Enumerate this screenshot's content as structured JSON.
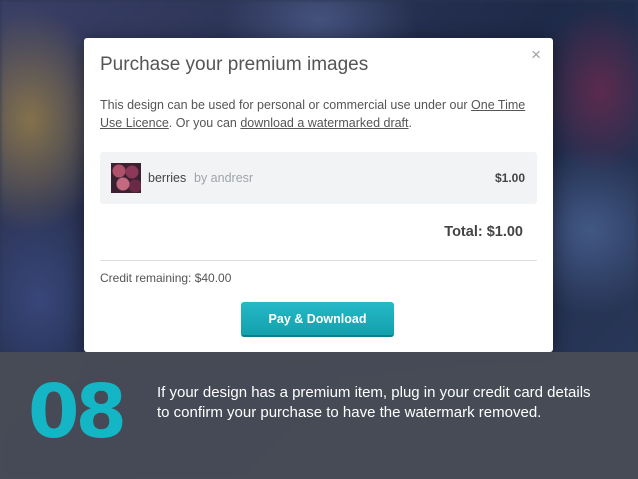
{
  "modal": {
    "title": "Purchase your premium images",
    "close_icon": "×",
    "description_prefix": "This design can be used for personal or commercial use under our ",
    "licence_link": "One Time Use Licence",
    "description_mid": ". Or you can ",
    "draft_link": "download a watermarked draft",
    "description_suffix": ".",
    "item": {
      "name": "berries",
      "author": "by andresr",
      "price": "$1.00"
    },
    "total": "Total: $1.00",
    "credit": "Credit remaining: $40.00",
    "pay_button": "Pay & Download"
  },
  "banner": {
    "step_number": "08",
    "text": "If your design has a premium item, plug in your credit card details to confirm your purchase to have the watermark removed.",
    "accent_color": "#14b5c4"
  }
}
